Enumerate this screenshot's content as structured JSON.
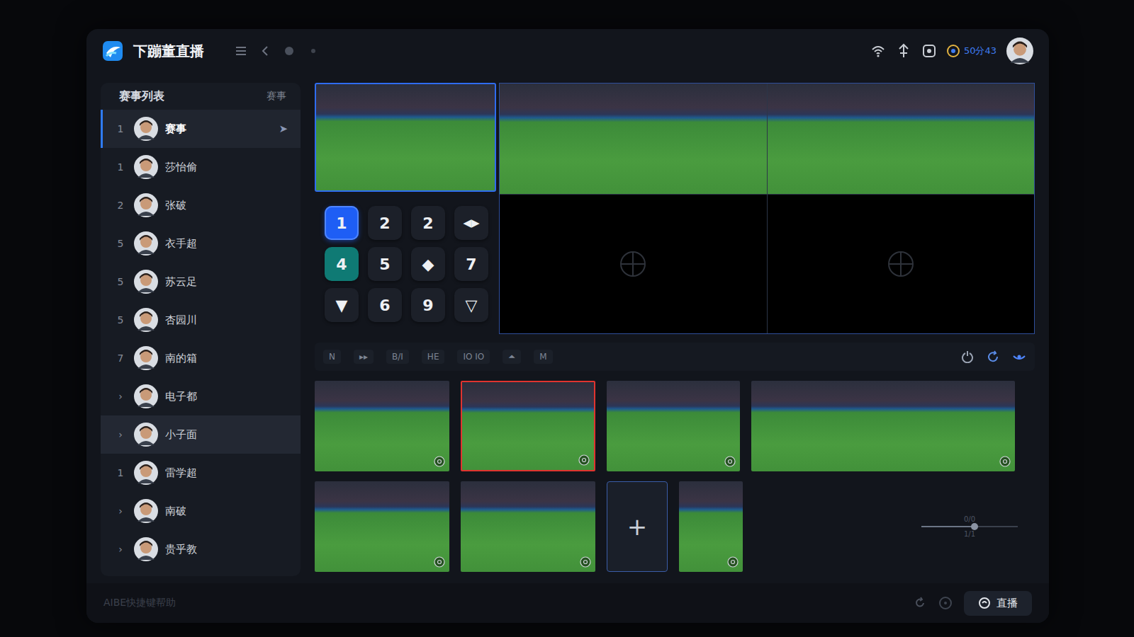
{
  "app": {
    "title": "下蹦董直播",
    "status": "50分43"
  },
  "sidebar": {
    "title": "赛事列表",
    "action": "赛事",
    "active_marker": "➤",
    "items": [
      {
        "index": "1",
        "name": "赛事",
        "selected": true,
        "highlighted": false
      },
      {
        "index": "1",
        "name": "莎怡偷",
        "selected": false,
        "highlighted": false
      },
      {
        "index": "2",
        "name": "张破",
        "selected": false,
        "highlighted": false
      },
      {
        "index": "5",
        "name": "衣手超",
        "selected": false,
        "highlighted": false
      },
      {
        "index": "5",
        "name": "苏云足",
        "selected": false,
        "highlighted": false
      },
      {
        "index": "5",
        "name": "杏园川",
        "selected": false,
        "highlighted": false
      },
      {
        "index": "7",
        "name": "南的箱",
        "selected": false,
        "highlighted": false
      },
      {
        "index": "›",
        "name": "电子都",
        "selected": false,
        "highlighted": false
      },
      {
        "index": "›",
        "name": "小子面",
        "selected": false,
        "highlighted": true
      },
      {
        "index": "1",
        "name": "雷学超",
        "selected": false,
        "highlighted": false
      },
      {
        "index": "›",
        "name": "南破",
        "selected": false,
        "highlighted": false
      },
      {
        "index": "›",
        "name": "贵乎教",
        "selected": false,
        "highlighted": false
      }
    ]
  },
  "preview": {
    "selected": true
  },
  "keypad": [
    {
      "label": "1",
      "selected": true,
      "color": "#1e5ef5"
    },
    {
      "label": "2",
      "selected": false,
      "color": "#1c2029"
    },
    {
      "label": "2",
      "selected": false,
      "color": "#1c2029"
    },
    {
      "label": "◀▶",
      "selected": false,
      "color": "#1c2029"
    },
    {
      "label": "4",
      "selected": false,
      "color": "#0f7a74"
    },
    {
      "label": "5",
      "selected": false,
      "color": "#1c2029"
    },
    {
      "label": "◆",
      "selected": false,
      "color": "#1c2029"
    },
    {
      "label": "7",
      "selected": false,
      "color": "#1c2029"
    },
    {
      "label": "▼",
      "selected": false,
      "color": "#1c2029"
    },
    {
      "label": "6",
      "selected": false,
      "color": "#1c2029"
    },
    {
      "label": "9",
      "selected": false,
      "color": "#1c2029"
    },
    {
      "label": "▽",
      "selected": false,
      "color": "#1c2029"
    }
  ],
  "grid": [
    {
      "kind": "video"
    },
    {
      "kind": "video"
    },
    {
      "kind": "empty"
    },
    {
      "kind": "empty"
    }
  ],
  "toolbar": [
    "N",
    "▸▸",
    "B/I",
    "HE",
    "IO IO",
    "⏶",
    "M"
  ],
  "thumbnails": [
    [
      {
        "kind": "video",
        "selected": false
      },
      {
        "kind": "video",
        "selected": true
      },
      {
        "kind": "video",
        "selected": false
      },
      {
        "kind": "video",
        "selected": false
      }
    ],
    [
      {
        "kind": "video",
        "selected": false
      },
      {
        "kind": "video",
        "selected": false
      },
      {
        "kind": "add",
        "label": "+",
        "selected": false
      },
      {
        "kind": "video",
        "selected": false
      }
    ]
  ],
  "slider": {
    "top": "0/0",
    "bottom": "1/1",
    "level": 0.55
  },
  "footer": {
    "hint": "AIBE快捷键帮助",
    "button": "直播"
  }
}
